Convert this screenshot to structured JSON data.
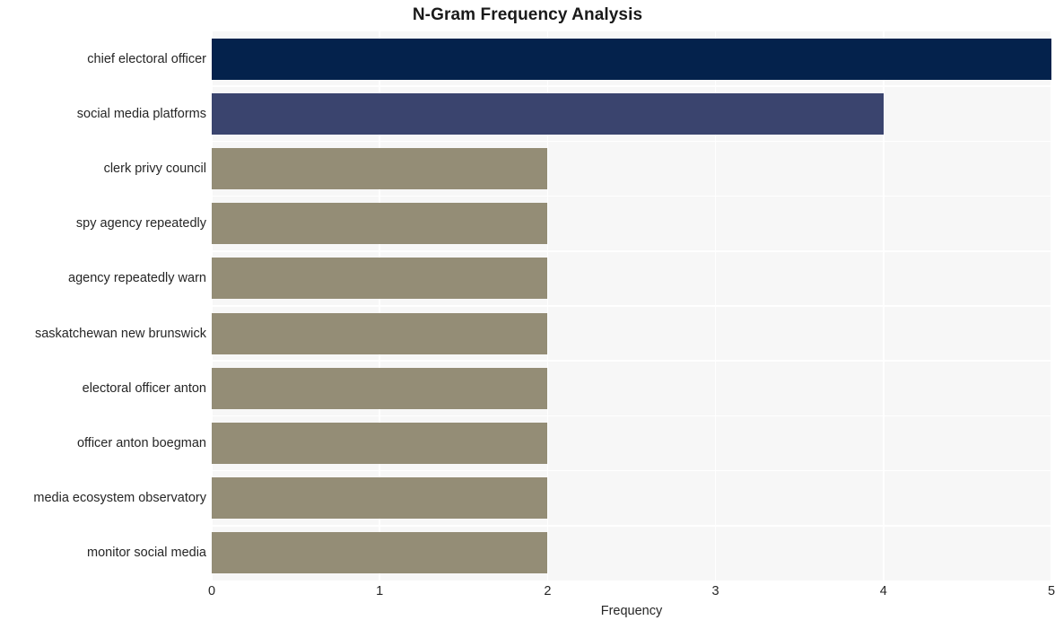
{
  "chart_data": {
    "type": "bar",
    "orientation": "horizontal",
    "title": "N-Gram Frequency Analysis",
    "xlabel": "Frequency",
    "ylabel": "",
    "xlim": [
      0,
      5
    ],
    "xticks": [
      "0",
      "1",
      "2",
      "3",
      "4",
      "5"
    ],
    "grid": true,
    "legend": "none",
    "categories": [
      "chief electoral officer",
      "social media platforms",
      "clerk privy council",
      "spy agency repeatedly",
      "agency repeatedly warn",
      "saskatchewan new brunswick",
      "electoral officer anton",
      "officer anton boegman",
      "media ecosystem observatory",
      "monitor social media"
    ],
    "values": [
      5,
      4,
      2,
      2,
      2,
      2,
      2,
      2,
      2,
      2
    ],
    "bar_colors": [
      "#04224c",
      "#3a446e",
      "#948d76",
      "#948d76",
      "#948d76",
      "#948d76",
      "#948d76",
      "#948d76",
      "#948d76",
      "#948d76"
    ]
  },
  "style": {
    "plot_background": "#f7f7f7",
    "figure_background": "#ffffff",
    "gridline_color": "#ffffff",
    "tick_text_color": "#262626",
    "title_color": "#1a1a1a"
  }
}
